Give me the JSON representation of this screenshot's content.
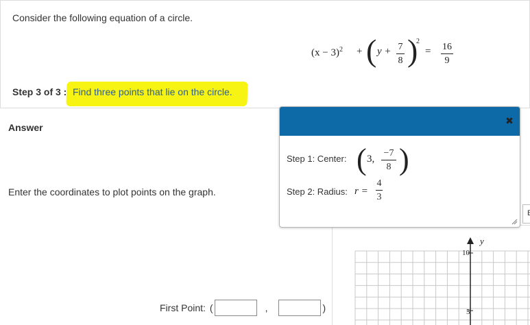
{
  "intro": "Consider the following equation of a circle.",
  "equation": {
    "term1": "(x − 3)",
    "term1_exp": "2",
    "plus1": "+",
    "y_plus": "y +",
    "frac1_num": "7",
    "frac1_den": "8",
    "outer_exp": "2",
    "equals": "=",
    "rhs_num": "16",
    "rhs_den": "9"
  },
  "step": {
    "prefix": "Step 3 of 3 :",
    "text": "Find three points that lie on the circle."
  },
  "answer_label": "Answer",
  "instructions": "Enter the coordinates to plot points on the graph.",
  "first_point": {
    "label": "First Point:",
    "open_paren": "(",
    "comma": ",",
    "close_paren": ")",
    "x_value": "",
    "y_value": ""
  },
  "side_button_label": "E",
  "popup": {
    "close_symbol": "✖",
    "step1_label": "Step 1: Center:",
    "step1_x": "3,",
    "step1_num": "−7",
    "step1_den": "8",
    "step2_label": "Step 2: Radius:",
    "step2_var": "r =",
    "step2_num": "4",
    "step2_den": "3"
  },
  "graph": {
    "y_axis_label": "y",
    "tick_10": "10",
    "tick_5": "5"
  },
  "colors": {
    "highlight": "#f7f312",
    "popup_header": "#0d6aa6",
    "step_text": "#2f5f8f"
  }
}
